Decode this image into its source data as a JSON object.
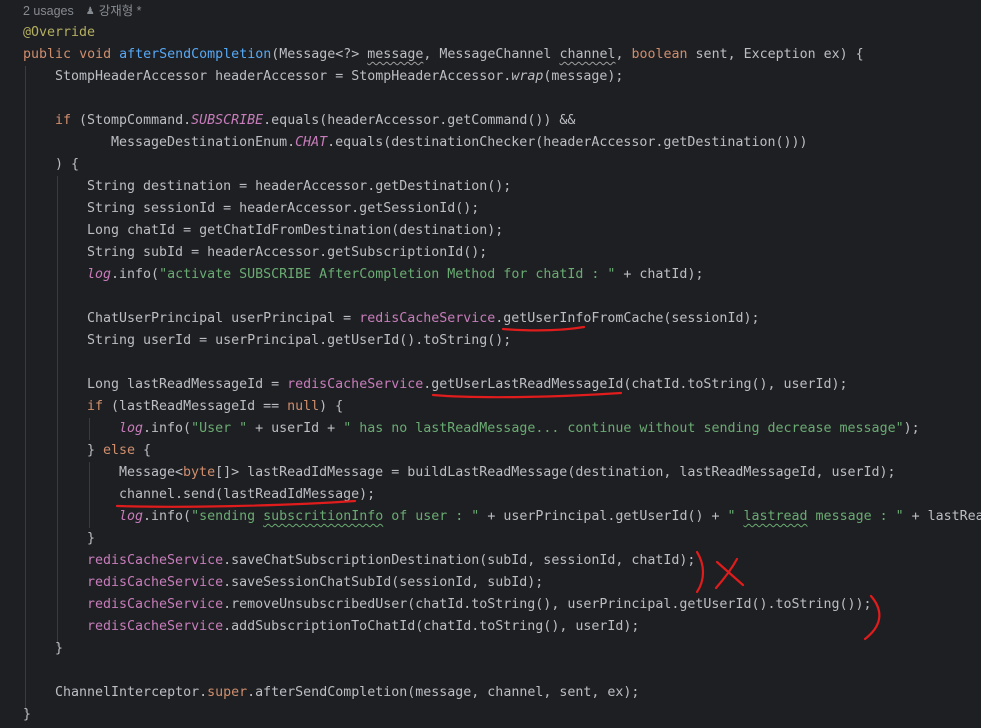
{
  "header": {
    "usages": "2 usages",
    "author": "강재형 *"
  },
  "tokens": {
    "override": "@Override",
    "kw_public": "public",
    "kw_void": "void",
    "method_name": "afterSendCompletion",
    "sig_a": "(Message<?> ",
    "p_message": "message",
    "sig_b": ", MessageChannel ",
    "p_channel": "channel",
    "sig_c": ", ",
    "kw_boolean": "boolean",
    "sig_d": " sent, Exception ex) {",
    "l3_a": "StompHeaderAccessor headerAccessor = StompHeaderAccessor.",
    "l3_wrap": "wrap",
    "l3_b": "(message);",
    "kw_if": "if",
    "l5_a": " (StompCommand.",
    "l5_subscribe": "SUBSCRIBE",
    "l5_b": ".equals(headerAccessor.getCommand()) &&",
    "l6_a": "MessageDestinationEnum.",
    "l6_chat": "CHAT",
    "l6_b": ".equals(destinationChecker(headerAccessor.getDestination()))",
    "l7": ") {",
    "l8": "String destination = headerAccessor.getDestination();",
    "l9": "String sessionId = headerAccessor.getSessionId();",
    "l10": "Long chatId = getChatIdFromDestination(destination);",
    "l11": "String subId = headerAccessor.getSubscriptionId();",
    "log": "log",
    "l12_a": ".info(",
    "l12_str": "\"activate SUBSCRIBE AfterCompletion Method for chatId : \"",
    "l12_b": " + chatId);",
    "l14_a": "ChatUserPrincipal userPrincipal = ",
    "redis": "redisCacheService",
    "l14_b": ".getUserInfoFromCache(sessionId);",
    "l15": "String userId = userPrincipal.getUserId().toString();",
    "l17_a": "Long lastReadMessageId = ",
    "l17_b": ".getUserLastReadMessageId(chatId.toString(), userId);",
    "l18_a": " (lastReadMessageId == ",
    "kw_null": "null",
    "l18_b": ") {",
    "l19_str": "\"User \"",
    "l19_b": " + userId + ",
    "l19_str2": "\" has no lastReadMessage... continue without sending decrease message\"",
    "l19_c": ");",
    "l20_a": "} ",
    "kw_else": "else",
    "l20_b": " {",
    "l21_a": "Message<",
    "kw_byte": "byte",
    "l21_b": "[]> lastReadIdMessage = buildLastReadMessage(destination, lastReadMessageId, userId);",
    "l22": "channel.send(lastReadIdMessage);",
    "l23_str_a": "\"sending ",
    "l23_typo": "subscritionInfo",
    "l23_str_b": " of user : \"",
    "l23_b": " + userPrincipal.getUserId() + ",
    "l23_str2_a": "\" ",
    "l23_typo2": "lastread",
    "l23_str2_b": " message : \"",
    "l23_c": " + lastReadMessageId);",
    "close": "}",
    "l25_b": ".saveChatSubscriptionDestination(subId, sessionId, chatId);",
    "l26_b": ".saveSessionChatSubId(sessionId, subId);",
    "l27_b": ".removeUnsubscribedUser(chatId.toString(), userPrincipal.getUserId().toString());",
    "l28_b": ".addSubscriptionToChatId(chatId.toString(), userId);",
    "l31_a": "ChannelInterceptor.",
    "kw_super": "super",
    "l31_b": ".afterSendCompletion(message, channel, sent, ex);"
  },
  "colors": {
    "background": "#1e1f22",
    "keyword": "#cf8e6d",
    "string": "#6aab73",
    "method_declaration": "#56a8f5",
    "field": "#c77dbb",
    "annotation": "#b3ae60",
    "default_text": "#bcbec4",
    "red_ink": "#e01c1c"
  }
}
